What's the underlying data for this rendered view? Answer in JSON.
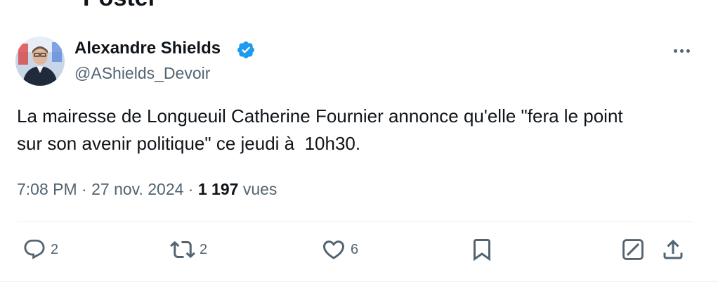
{
  "header": {
    "title": "Poster"
  },
  "tweet": {
    "author_name": "Alexandre Shields",
    "handle": "@AShields_Devoir",
    "text_lines": [
      "La mairesse de Longueuil Catherine Fournier annonce qu'elle \"fera le point",
      "sur son avenir politique\" ce jeudi à  10h30."
    ],
    "time": "7:08 PM",
    "separator": "·",
    "date": "27 nov. 2024",
    "views_count": "1 197",
    "views_label": "vues"
  },
  "actions": {
    "reply_count": "2",
    "retweet_count": "2",
    "like_count": "6"
  },
  "icons": {
    "verified": "verified-badge-icon",
    "more": "more-horizontal-icon",
    "reply": "reply-icon",
    "retweet": "retweet-icon",
    "like": "heart-icon",
    "bookmark": "bookmark-icon",
    "grok": "grok-icon",
    "share": "share-icon"
  },
  "colors": {
    "text_primary": "#0f1419",
    "text_secondary": "#536471",
    "verified_blue": "#1d9bf0",
    "divider": "#eff3f4"
  }
}
